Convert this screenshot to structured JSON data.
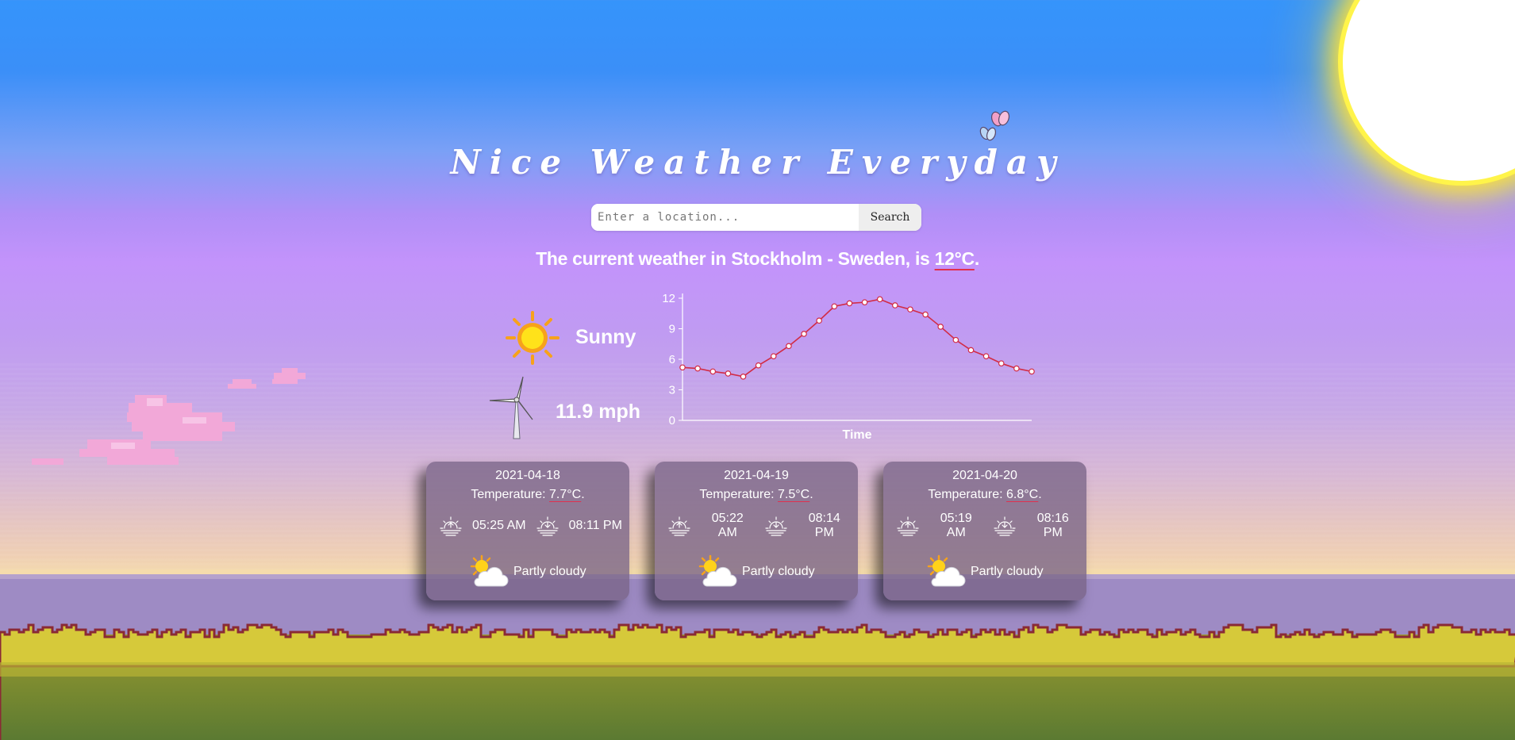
{
  "app": {
    "title": "Nice Weather Everyday"
  },
  "search": {
    "placeholder": "Enter a location...",
    "value": "",
    "button_label": "Search"
  },
  "current": {
    "prefix": "The current weather in Stockholm - Sweden, is ",
    "temperature": "12°C",
    "suffix": ".",
    "condition": "Sunny",
    "condition_icon": "sun-icon",
    "wind": "11.9 mph",
    "wind_icon": "wind-turbine-icon"
  },
  "chart_data": {
    "type": "line",
    "title": "",
    "xlabel": "Time",
    "ylabel": "",
    "yticks": [
      0,
      3,
      6,
      9,
      12
    ],
    "ylim": [
      0,
      12
    ],
    "grid": false,
    "series": [
      {
        "values": [
          5.2,
          5.1,
          4.8,
          4.6,
          4.3,
          5.4,
          6.3,
          7.3,
          8.5,
          9.8,
          11.2,
          11.5,
          11.6,
          11.9,
          11.3,
          10.9,
          10.4,
          9.2,
          7.9,
          6.9,
          6.3,
          5.6,
          5.1,
          4.8
        ],
        "color": "#d22b45"
      }
    ]
  },
  "forecast": [
    {
      "date": "2021-04-18",
      "temp_label": "Temperature: ",
      "temp": "7.7°C",
      "temp_suffix": ".",
      "sunrise": "05:25 AM",
      "sunset": "08:11 PM",
      "condition": "Partly cloudy",
      "condition_icon": "partly-cloudy-icon"
    },
    {
      "date": "2021-04-19",
      "temp_label": "Temperature: ",
      "temp": "7.5°C",
      "temp_suffix": ".",
      "sunrise": "05:22 AM",
      "sunset": "08:14 PM",
      "condition": "Partly cloudy",
      "condition_icon": "partly-cloudy-icon"
    },
    {
      "date": "2021-04-20",
      "temp_label": "Temperature: ",
      "temp": "6.8°C",
      "temp_suffix": ".",
      "sunrise": "05:19 AM",
      "sunset": "08:16 PM",
      "condition": "Partly cloudy",
      "condition_icon": "partly-cloudy-icon"
    }
  ],
  "colors": {
    "sky_top": "#3594fb",
    "sky_mid": "#c393fb",
    "accent_underline": "#e0304e",
    "chart_line": "#d22b45",
    "grass": "#d6c93a"
  }
}
